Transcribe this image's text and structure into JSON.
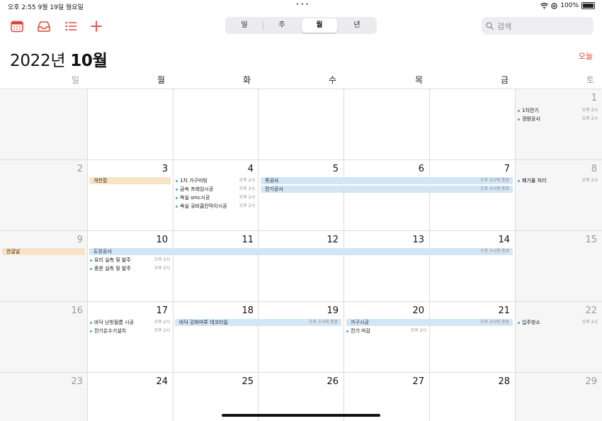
{
  "status": {
    "time": "오후 2:55",
    "date": "9월 19일 월요일",
    "battery": "100%"
  },
  "toolbar": {
    "icons": [
      "calendar-icon",
      "inbox-icon",
      "list-icon",
      "add-icon"
    ]
  },
  "view_tabs": [
    {
      "label": "일"
    },
    {
      "label": "주"
    },
    {
      "label": "월",
      "active": true
    },
    {
      "label": "년"
    }
  ],
  "search": {
    "placeholder": "검색"
  },
  "header": {
    "year": "2022년 ",
    "month": "10월",
    "today_label": "오늘"
  },
  "weekdays": [
    "일",
    "월",
    "화",
    "수",
    "목",
    "금",
    "토"
  ],
  "weeks": [
    {
      "days": [
        "",
        "",
        "",
        "",
        "",
        "",
        "1"
      ]
    },
    {
      "days": [
        "2",
        "3",
        "4",
        "5",
        "6",
        "7",
        "8"
      ]
    },
    {
      "days": [
        "9",
        "10",
        "11",
        "12",
        "13",
        "14",
        "15"
      ]
    },
    {
      "days": [
        "16",
        "17",
        "18",
        "19",
        "20",
        "21",
        "22"
      ]
    },
    {
      "days": [
        "23",
        "24",
        "25",
        "26",
        "27",
        "28",
        "29"
      ]
    }
  ],
  "events": {
    "w0_sat_1": {
      "title": "1차전기",
      "time": "오후 2시"
    },
    "w0_sat_2": {
      "title": "경량공사",
      "time": "오후 2시"
    },
    "w1_mon_allday": {
      "title": "개천절"
    },
    "w1_tue_1": {
      "title": "1차 가구미팅",
      "time": "오후 2시"
    },
    "w1_tue_2": {
      "title": "금속 프레임시공",
      "time": "오후 2시"
    },
    "w1_tue_3": {
      "title": "욕실 smc시공",
      "time": "오후 2시"
    },
    "w1_tue_4": {
      "title": "욕실 큐비클칸막이시공",
      "time": "오후 2시"
    },
    "w1_span_1": {
      "title": "목공사",
      "time": "오후 3시에 종료"
    },
    "w1_span_2": {
      "title": "전기공사",
      "time": "오후 3시에 종료"
    },
    "w1_sat_1": {
      "title": "폐기물 처리",
      "time": "오후 2시"
    },
    "w2_sun_allday": {
      "title": "한글날"
    },
    "w2_span_1": {
      "title": "도장공사",
      "time": "오후 3시에 종료"
    },
    "w2_mon_1": {
      "title": "유리 실측 및 발주",
      "time": "오후 2시"
    },
    "w2_mon_2": {
      "title": "중문 실측 및 발주",
      "time": "오후 2시"
    },
    "w3_mon_1": {
      "title": "바닥 난방필름 시공",
      "time": "오후 2시"
    },
    "w3_mon_2": {
      "title": "전기온수기설치",
      "time": "오후 2시"
    },
    "w3_span_1": {
      "title": "바닥 강화마루 데코타일",
      "time": "오후 3시에 종료"
    },
    "w3_span_2": {
      "title": "가구시공",
      "time": "오후 3시에 종료"
    },
    "w3_thu_1": {
      "title": "전기 마감",
      "time": "오후 2시"
    },
    "w3_sat_1": {
      "title": "입주청소",
      "time": "오후 2시"
    }
  },
  "colors": {
    "accent": "#e0433a",
    "event_blue": "#d3e6f5",
    "holiday_orange": "#f7e3c5",
    "dot": "#4ea0d8"
  }
}
